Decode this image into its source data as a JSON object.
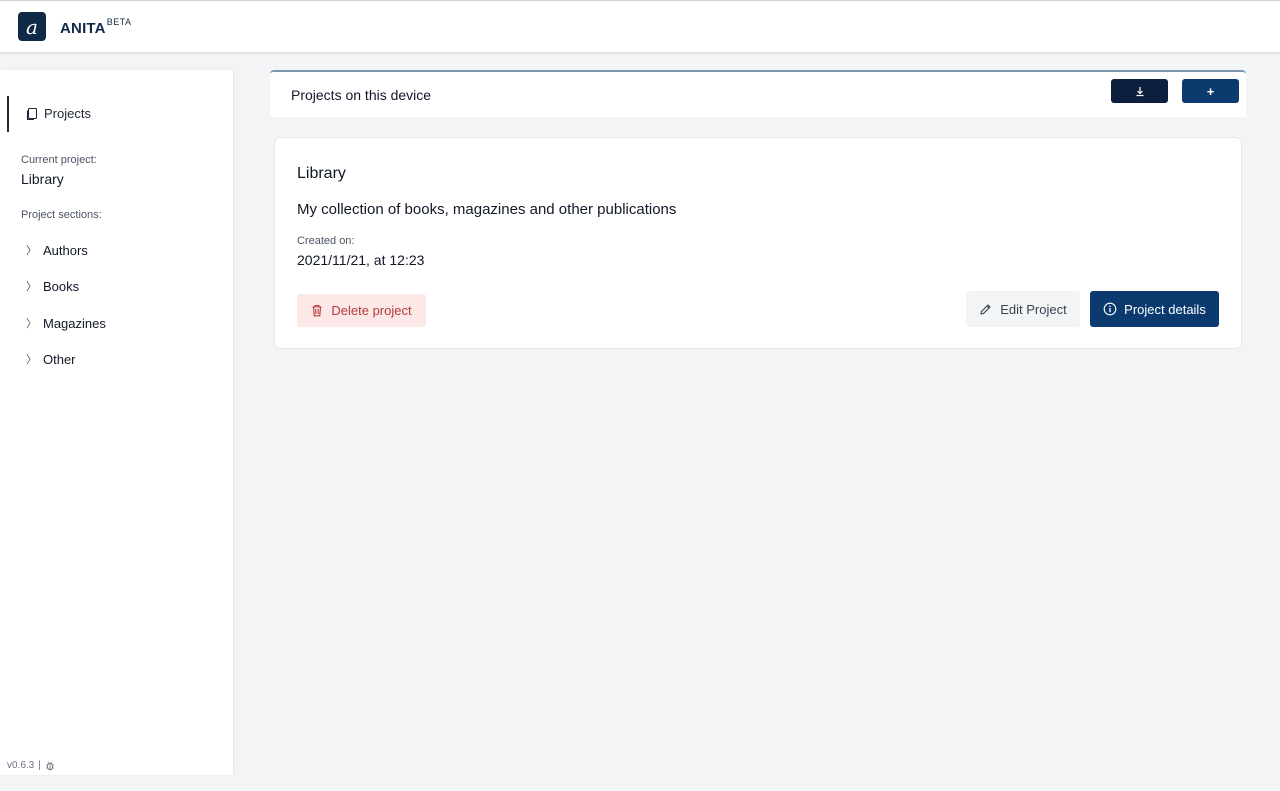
{
  "header": {
    "logo_glyph": "a",
    "brand_name": "ANITA",
    "brand_badge": "BETA"
  },
  "sidebar": {
    "nav_projects_label": "Projects",
    "current_project_label": "Current project:",
    "current_project_value": "Library",
    "sections_label": "Project sections:",
    "sections": [
      {
        "label": "Authors",
        "icon": "chevron-right-icon"
      },
      {
        "label": "Books",
        "icon": "chevron-right-icon"
      },
      {
        "label": "Magazines",
        "icon": "chevron-right-icon"
      },
      {
        "label": "Other",
        "icon": "chevron-right-icon"
      }
    ],
    "version": "v0.6.3",
    "version_separator": "|"
  },
  "main": {
    "title": "Projects on this device",
    "import_icon": "download-icon",
    "add_label": "+"
  },
  "project": {
    "name": "Library",
    "description": "My collection of books, magazines and other publications",
    "created_label": "Created on:",
    "created_value": "2021/11/21, at 12:23",
    "delete_label": "Delete project",
    "edit_label": "Edit Project",
    "details_label": "Project details"
  },
  "colors": {
    "brand_navy": "#0f2a47",
    "primary_button": "#0b3a6e",
    "import_button": "#0d1f3c",
    "delete_bg": "#fde8e8",
    "delete_text": "#b23b3b",
    "page_bg": "#f3f4f6"
  }
}
